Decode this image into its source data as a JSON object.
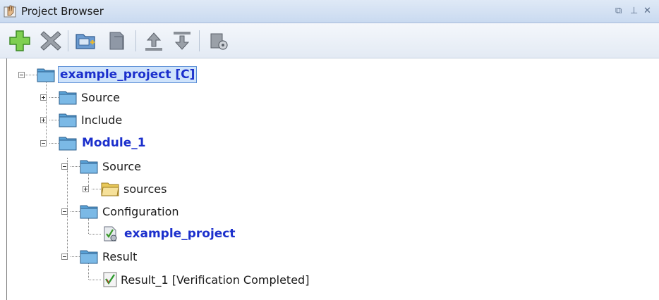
{
  "window": {
    "title": "Project Browser",
    "controls": [
      "restore-icon",
      "pin-icon",
      "close-icon"
    ]
  },
  "toolbar": {
    "buttons": [
      "add-icon",
      "delete-icon",
      "new-folder-icon",
      "copy-icon",
      "move-up-icon",
      "move-down-icon",
      "properties-icon"
    ]
  },
  "tree": {
    "project": {
      "label": "example_project [C]"
    },
    "source": {
      "label": "Source"
    },
    "include": {
      "label": "Include"
    },
    "module": {
      "label": "Module_1"
    },
    "module_source": {
      "label": "Source"
    },
    "sources": {
      "label": "sources"
    },
    "configuration": {
      "label": "Configuration"
    },
    "config_item": {
      "label": "example_project"
    },
    "result": {
      "label": "Result"
    },
    "result_item": {
      "label": "Result_1 [Verification Completed]"
    }
  },
  "colors": {
    "accent_blue": "#1b2fcc",
    "selection": "#cfe3fb",
    "folder_blue": "#5aa3d8",
    "folder_yellow": "#f2d77a"
  }
}
